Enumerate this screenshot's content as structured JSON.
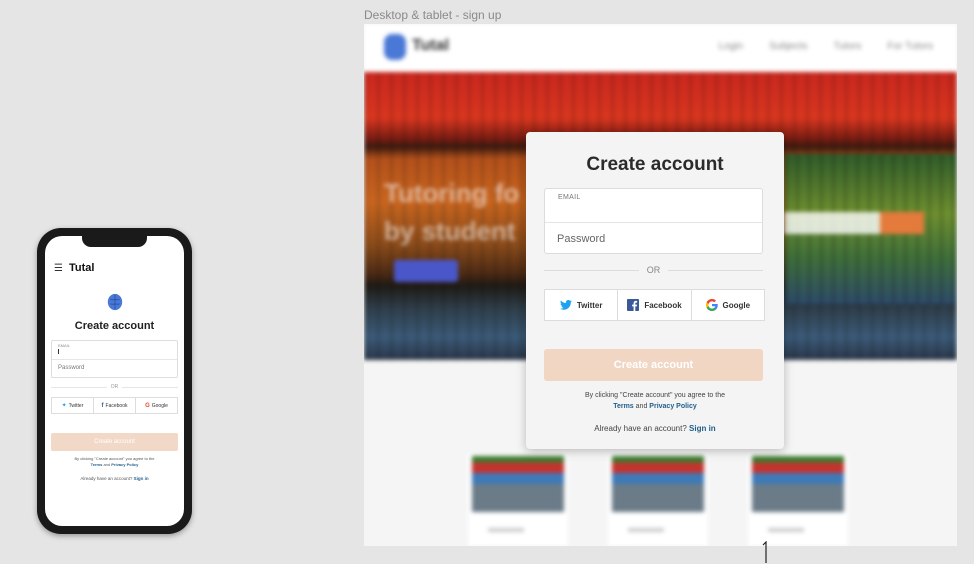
{
  "canvas": {
    "frame_label": "Desktop & tablet - sign up"
  },
  "mobile": {
    "logo": "Tutal",
    "title": "Create account",
    "email_label": "EMAIL",
    "password_placeholder": "Password",
    "or_label": "OR",
    "social": {
      "twitter": "Twitter",
      "facebook": "Facebook",
      "google": "Google"
    },
    "create_button": "Create account",
    "terms_prefix": "By clicking \"Create account\" you agree to the",
    "terms_link": "Terms",
    "terms_and": "and",
    "privacy_link": "Privacy Policy",
    "already_text": "Already have an account?",
    "sign_in_link": "Sign in"
  },
  "desktop": {
    "logo": "Tutal",
    "nav": [
      "Login",
      "Subjects",
      "Tutors",
      "For Tutors"
    ],
    "hero_text_line1": "Tutoring fo",
    "hero_text_line2": "by student"
  },
  "modal": {
    "title": "Create account",
    "email_label": "EMAIL",
    "email_value": "",
    "password_placeholder": "Password",
    "or_label": "OR",
    "social": {
      "twitter": "Twitter",
      "facebook": "Facebook",
      "google": "Google"
    },
    "create_button": "Create account",
    "terms_prefix": "By clicking \"Create account\" you agree to the",
    "terms_link": "Terms",
    "terms_and": "and",
    "privacy_link": "Privacy Policy",
    "already_text": "Already have an account?",
    "sign_in_link": "Sign in"
  },
  "colors": {
    "accent_link": "#1f5f8b",
    "create_button_bg": "#f0d6c3",
    "twitter": "#1da1f2",
    "facebook": "#3b5998"
  }
}
